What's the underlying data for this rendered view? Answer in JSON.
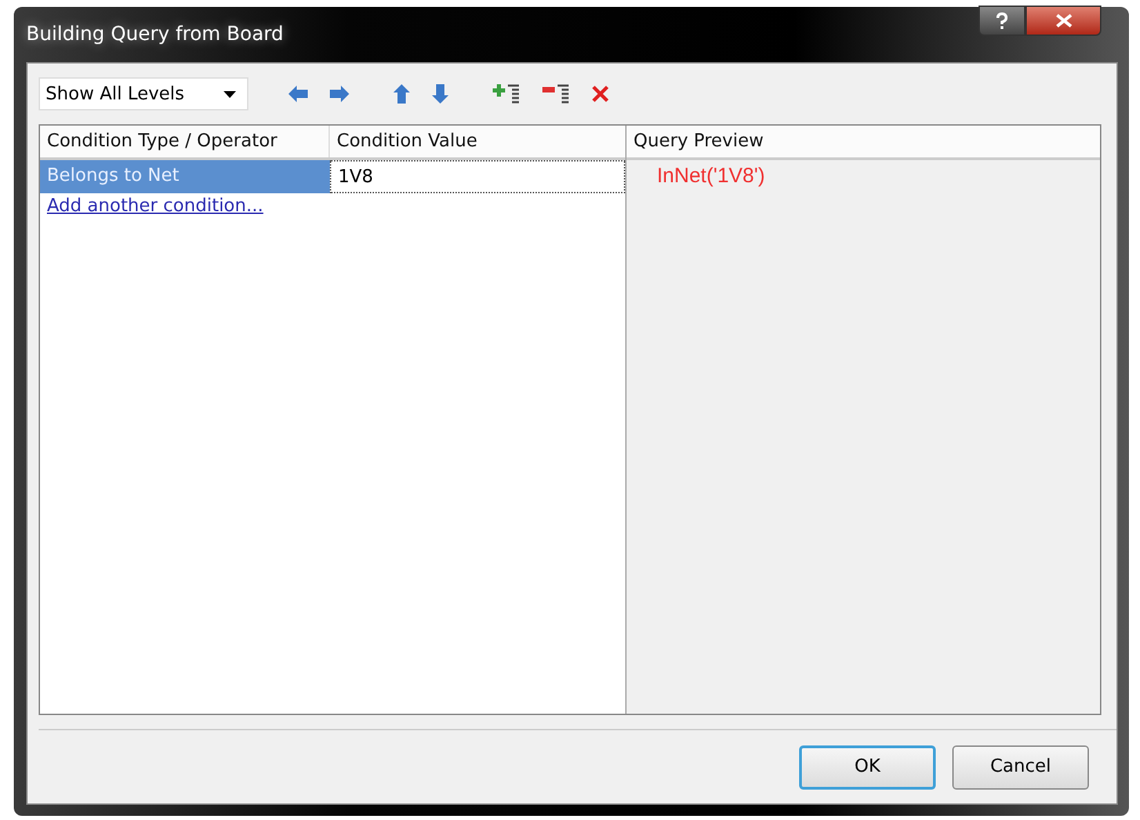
{
  "window": {
    "title": "Building Query from Board"
  },
  "toolbar": {
    "level_filter": "Show All Levels"
  },
  "conditions": {
    "columns": [
      "Condition Type / Operator",
      "Condition Value"
    ],
    "rows": [
      {
        "type": "Belongs to Net",
        "value": "1V8",
        "selected": true
      }
    ],
    "add_link": "Add another condition..."
  },
  "preview": {
    "heading": "Query Preview",
    "query": "InNet('1V8')"
  },
  "buttons": [
    {
      "label": "OK",
      "default": true
    },
    {
      "label": "Cancel",
      "default": false
    }
  ]
}
